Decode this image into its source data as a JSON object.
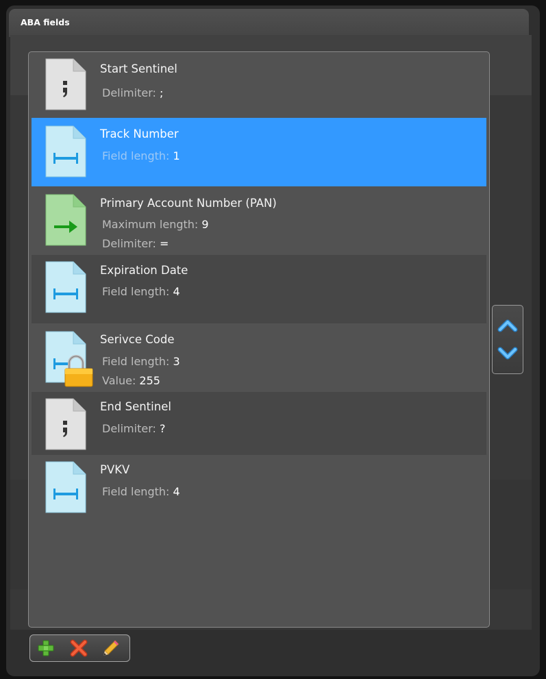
{
  "panel": {
    "title": "ABA fields"
  },
  "fields": [
    {
      "name": "Start Sentinel",
      "icon": "semicolon-doc-icon",
      "props": [
        {
          "key": "Delimiter:",
          "value": ";"
        }
      ]
    },
    {
      "name": "Track Number",
      "icon": "fixed-length-doc-icon",
      "selected": true,
      "props": [
        {
          "key": "Field length:",
          "value": "1"
        }
      ]
    },
    {
      "name": "Primary Account Number (PAN)",
      "icon": "variable-length-doc-icon",
      "props": [
        {
          "key": "Maximum length:",
          "value": "9"
        },
        {
          "key": "Delimiter:",
          "value": "="
        }
      ]
    },
    {
      "name": "Expiration Date",
      "icon": "fixed-length-doc-icon",
      "props": [
        {
          "key": "Field length:",
          "value": "4"
        }
      ]
    },
    {
      "name": "Serivce Code",
      "icon": "locked-fixed-length-doc-icon",
      "props": [
        {
          "key": "Field length:",
          "value": "3"
        },
        {
          "key": "Value:",
          "value": "255"
        }
      ]
    },
    {
      "name": "End Sentinel",
      "icon": "semicolon-doc-icon",
      "props": [
        {
          "key": "Delimiter:",
          "value": "?"
        }
      ]
    },
    {
      "name": "PVKV",
      "icon": "fixed-length-doc-icon",
      "props": [
        {
          "key": "Field length:",
          "value": "4"
        }
      ]
    }
  ],
  "reorder": {
    "up_icon": "chevron-up-icon",
    "down_icon": "chevron-down-icon"
  },
  "toolbar": {
    "add_icon": "plus-icon",
    "delete_icon": "x-icon",
    "edit_icon": "pencil-icon"
  },
  "colors": {
    "selection": "#3399ff",
    "panel_bg": "#2f2f2f",
    "list_bg": "#525252",
    "fixed_length_doc": "#c8ecf7",
    "variable_length_doc": "#a8dca0",
    "delimiter_doc": "#e0e0e0",
    "lock": "#f5b01a"
  }
}
